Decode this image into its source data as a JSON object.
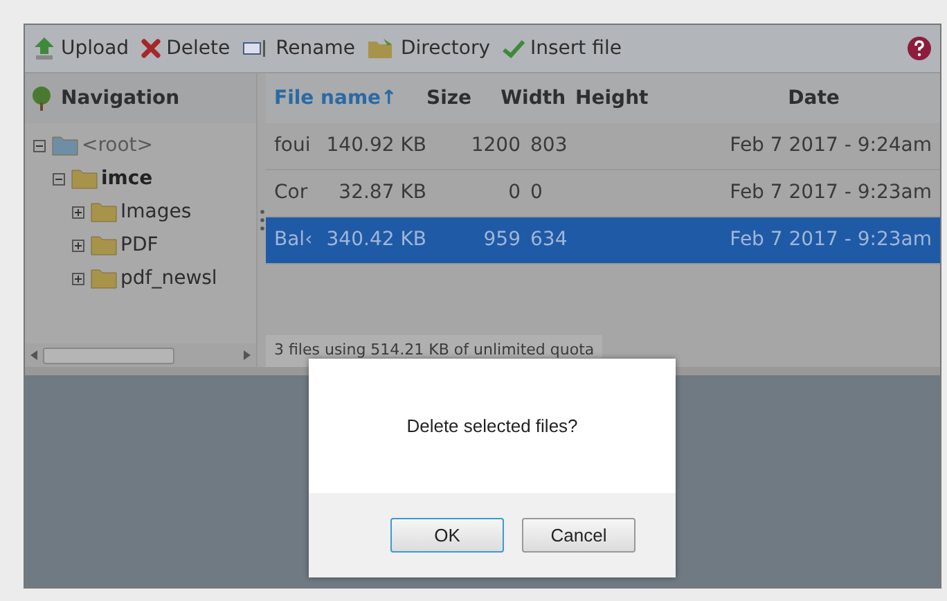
{
  "toolbar": [
    {
      "kind": "upload",
      "label": "Upload"
    },
    {
      "kind": "delete",
      "label": "Delete"
    },
    {
      "kind": "rename",
      "label": "Rename"
    },
    {
      "kind": "directory",
      "label": "Directory"
    },
    {
      "kind": "insert",
      "label": "Insert file"
    }
  ],
  "navigation": {
    "title": "Navigation",
    "tree": [
      {
        "label": "<root>",
        "expanded": true,
        "bold": false,
        "children": [
          {
            "label": "imce",
            "expanded": true,
            "bold": true,
            "children": [
              {
                "label": "Images",
                "expanded": false,
                "bold": false
              },
              {
                "label": "PDF",
                "expanded": false,
                "bold": false
              },
              {
                "label": "pdf_newsl",
                "expanded": false,
                "bold": false
              }
            ]
          }
        ]
      }
    ]
  },
  "table": {
    "columns": [
      {
        "label": "File name",
        "sort_mark": "↑",
        "sorted": true
      },
      {
        "label": "Size",
        "sorted": false
      },
      {
        "label": "Width",
        "sorted": false
      },
      {
        "label": "Height",
        "sorted": false
      },
      {
        "label": "Date",
        "sorted": false
      }
    ],
    "rows": [
      {
        "cells": [
          "foui",
          "140.92 KB",
          "1200",
          "803",
          "Feb 7 2017 - 9:24am"
        ],
        "selected": false
      },
      {
        "cells": [
          "Cor",
          "32.87 KB",
          "0",
          "0",
          "Feb 7 2017 - 9:23am"
        ],
        "selected": false
      },
      {
        "cells": [
          "Bal‹",
          "340.42 KB",
          "959",
          "634",
          "Feb 7 2017 - 9:23am"
        ],
        "selected": true
      }
    ]
  },
  "status_bar": "3 files using 514.21 KB of unlimited quota",
  "dialog": {
    "message": "Delete selected files?",
    "buttons": [
      {
        "label": "OK",
        "default": true
      },
      {
        "label": "Cancel",
        "default": false
      }
    ]
  }
}
